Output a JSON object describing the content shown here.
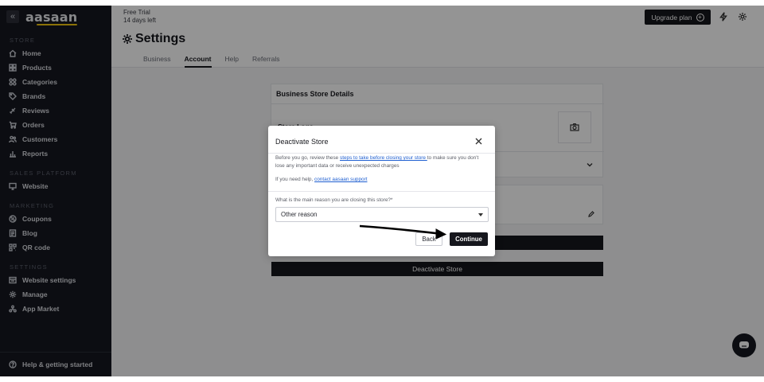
{
  "brand": {
    "logo_text": "aasaan",
    "collapse_glyph": "«",
    "accent": "#f1c40f"
  },
  "sidebar": {
    "sections": [
      {
        "title": "STORE",
        "items": [
          {
            "label": "Home",
            "icon": "home-icon"
          },
          {
            "label": "Products",
            "icon": "products-icon"
          },
          {
            "label": "Categories",
            "icon": "categories-icon"
          },
          {
            "label": "Brands",
            "icon": "tag-icon"
          },
          {
            "label": "Reviews",
            "icon": "reviews-icon"
          },
          {
            "label": "Orders",
            "icon": "cart-icon"
          },
          {
            "label": "Customers",
            "icon": "users-icon"
          },
          {
            "label": "Reports",
            "icon": "chart-icon"
          }
        ]
      },
      {
        "title": "SALES PLATFORM",
        "items": [
          {
            "label": "Website",
            "icon": "monitor-icon"
          }
        ]
      },
      {
        "title": "MARKETING",
        "items": [
          {
            "label": "Coupons",
            "icon": "coupon-icon"
          },
          {
            "label": "Blog",
            "icon": "blog-icon"
          },
          {
            "label": "QR code",
            "icon": "qr-icon"
          }
        ]
      },
      {
        "title": "SETTINGS",
        "items": [
          {
            "label": "Website settings",
            "icon": "website-settings-icon"
          },
          {
            "label": "Manage",
            "icon": "gear-icon"
          },
          {
            "label": "App Market",
            "icon": "app-market-icon"
          }
        ]
      }
    ],
    "bottom": {
      "label": "Help & getting started",
      "icon": "help-icon"
    }
  },
  "topbar": {
    "trial_line1": "Free Trial",
    "trial_line2": "14 days left",
    "upgrade_label": "Upgrade plan",
    "upgrade_glyph": "+"
  },
  "header": {
    "title": "Settings",
    "tabs": [
      "Business",
      "Account",
      "Help",
      "Referrals"
    ],
    "active_tab": "Account"
  },
  "content": {
    "card_title": "Business Store Details",
    "store_logo_label": "Store Logo",
    "deactivate_label": "Deactivate Store"
  },
  "modal": {
    "title": "Deactivate Store",
    "text_before_link": "Before you go, review these ",
    "link1": "steps to take before closing your store ",
    "text_after_link": "to make sure you don't lose any important data or receive unexpected charges",
    "help_text": "If you need help, ",
    "link2": "contact aasaan support",
    "select_label": "What is the main reason you are closing this store?*",
    "select_value": "Other reason",
    "back_label": "Back",
    "continue_label": "Continue"
  },
  "colors": {
    "sidebar_bg": "#15171f",
    "button_dark": "#16171d",
    "link": "#1f5fd1"
  }
}
